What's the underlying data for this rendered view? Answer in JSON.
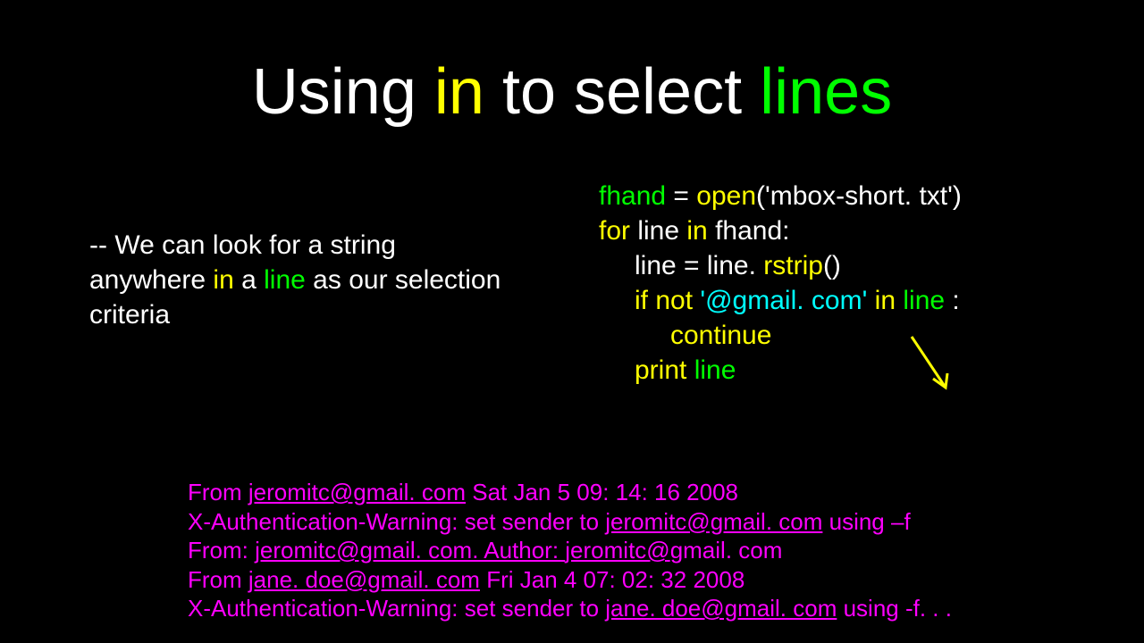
{
  "title": {
    "part1": "Using ",
    "part2": "in",
    "part3": " to select ",
    "part4": "lines"
  },
  "bullet": {
    "prefix": "-- We can look for a string anywhere ",
    "in": "in",
    "mid": " a ",
    "line": "line",
    "suffix": " as our selection criteria"
  },
  "code": {
    "l1a": "fhand",
    "l1b": " = ",
    "l1c": "open",
    "l1d": "('mbox-short. txt')",
    "l2a": "for",
    "l2b": " line ",
    "l2c": "in",
    "l2d": " fhand:",
    "l3a": "line = line. ",
    "l3b": "rstrip",
    "l3c": "()",
    "l4a": "if not ",
    "l4b": "'@gmail. com'",
    "l4c": " in ",
    "l4d": "line",
    "l4e": " :",
    "l5a": "continue",
    "l6a": "print",
    "l6b": " line"
  },
  "output": {
    "l1a": "From ",
    "l1b": "jeromitc@gmail. com",
    "l1c": " Sat Jan  5 09: 14: 16 2008",
    "l2a": "X-Authentication-Warning: set sender to ",
    "l2b": "jeromitc@gmail. com",
    "l2c": " using –f",
    "l3a": "From: ",
    "l3b": "jeromitc@gmail. com. Author: ",
    "l3c": "jeromitc@",
    "l3d": "gmail. com",
    "l4a": "From ",
    "l4b": "jane. doe@gmail. com",
    "l4c": " Fri Jan  4 07: 02: 32 2008",
    "l5a": "X-Authentication-Warning: set sender to ",
    "l5b": "jane. doe@gmail. com",
    "l5c": " using -f. . ."
  }
}
